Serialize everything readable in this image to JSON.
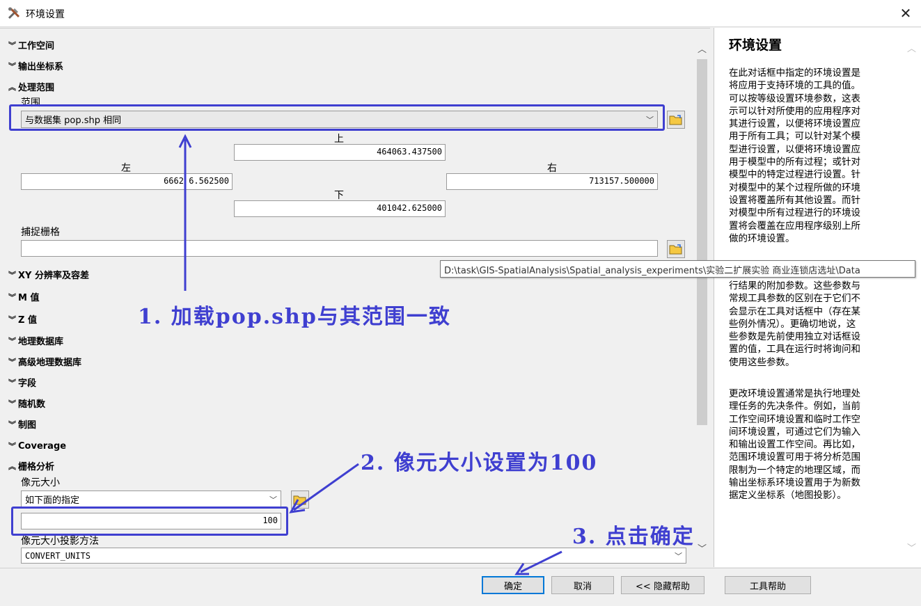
{
  "window": {
    "title": "环境设置",
    "close_glyph": "✕"
  },
  "sections": {
    "workspace": "工作空间",
    "output_coords": "输出坐标系",
    "processing_extent": "处理范围",
    "xy_resolution": "XY 分辨率及容差",
    "m_values": "M 值",
    "z_values": "Z 值",
    "geodatabase": "地理数据库",
    "advanced_geodatabase": "高级地理数据库",
    "fields": "字段",
    "random_numbers": "随机数",
    "cartography": "制图",
    "coverage": "Coverage",
    "raster_analysis": "栅格分析"
  },
  "extent": {
    "label": "范围",
    "selected": "与数据集 pop.shp 相同",
    "top_label": "上",
    "top_value": "464063.437500",
    "left_label": "左",
    "left_value": "6662 6.562500",
    "right_label": "右",
    "right_value": "713157.500000",
    "bottom_label": "下",
    "bottom_value": "401042.625000"
  },
  "snap_raster": {
    "label": "捕捉栅格",
    "value": ""
  },
  "raster": {
    "cell_size_label": "像元大小",
    "cell_size_option": "如下面的指定",
    "cell_size_value": "100",
    "projection_method_label": "像元大小投影方法",
    "projection_method_value": "CONVERT_UNITS"
  },
  "tooltip": "D:\\task\\GIS-SpatialAnalysis\\Spatial_analysis_experiments\\实验二扩展实验 商业连锁店选址\\Data",
  "annotations": {
    "step1": "1. 加载pop.shp与其范围一致",
    "step2": "2. 像元大小设置为100",
    "step3": "3. 点击确定"
  },
  "help": {
    "title": "环境设置",
    "p1_lines": [
      "在此对话框中指定的环境设置是",
      "将应用于支持环境的工具的值。",
      "可以按等级设置环境参数，这表",
      "示可以针对所使用的应用程序对",
      "其进行设置，以便将环境设置应",
      "用于所有工具；可以针对某个模",
      "型进行设置，以便将环境设置应",
      "用于模型中的所有过程；或针对",
      "模型中的特定过程进行设置。针",
      "对模型中的某个过程所做的环境",
      "设置将覆盖所有其他设置。而针",
      "对模型中所有过程进行的环境设",
      "置将会覆盖在应用程序级别上所",
      "做的环境设置。"
    ],
    "p2_lines": [
      "行结果的附加参数。这些参数与",
      "常规工具参数的区别在于它们不",
      "会显示在工具对话框中（存在某",
      "些例外情况）。更确切地说，这",
      "些参数是先前使用独立对话框设",
      "置的值，工具在运行时将询问和",
      "使用这些参数。"
    ],
    "p3_lines": [
      "更改环境设置通常是执行地理处",
      "理任务的先决条件。例如，当前",
      "工作空间环境设置和临时工作空",
      "间环境设置，可通过它们为输入",
      "和输出设置工作空间。再比如，",
      "范围环境设置可用于将分析范围",
      "限制为一个特定的地理区域，而",
      "输出坐标系环境设置用于为新数",
      "据定义坐标系（地图投影）。"
    ]
  },
  "buttons": {
    "ok": "确定",
    "cancel": "取消",
    "hide_help": "<< 隐藏帮助",
    "tool_help": "工具帮助"
  },
  "colors": {
    "annotation": "#3f3fd0",
    "ok_border": "#0078d7"
  }
}
